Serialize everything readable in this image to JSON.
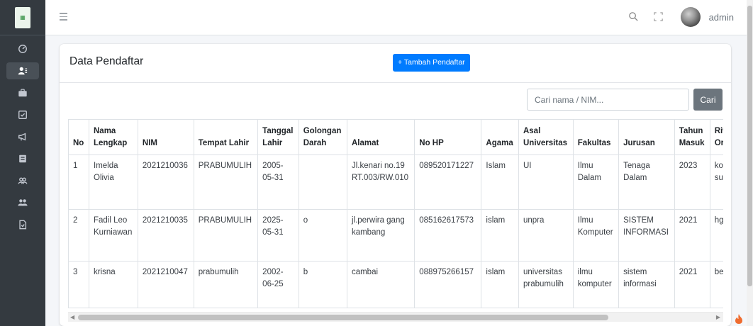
{
  "user": {
    "name": "admin"
  },
  "sidebar": {
    "icons": [
      "dashboard-icon",
      "users-icon",
      "briefcase-icon",
      "checkbox-icon",
      "megaphone-icon",
      "calendar-icon",
      "group-icon",
      "team-icon",
      "document-icon"
    ],
    "active_index": 1
  },
  "card": {
    "title": "Data Pendaftar",
    "add_button": "+ Tambah Pendaftar"
  },
  "search": {
    "placeholder": "Cari nama / NIM...",
    "button": "Cari"
  },
  "table": {
    "columns": [
      "No",
      "Nama Lengkap",
      "NIM",
      "Tempat Lahir",
      "Tanggal Lahir",
      "Golongan Darah",
      "Alamat",
      "No HP",
      "Agama",
      "Asal Universitas",
      "Fakultas",
      "Jurusan",
      "Tahun Masuk",
      "Riwayat Organisasi"
    ],
    "rows": [
      [
        "1",
        "Imelda Olivia",
        "2021210036",
        "PRABUMULIH",
        "2005-05-31",
        "",
        "Jl.kenari no.19 RT.003/RW.010",
        "089520171227",
        "Islam",
        "UI",
        "Ilmu Dalam",
        "Tenaga Dalam",
        "2023",
        "komnutas suka suka"
      ],
      [
        "2",
        "Fadil Leo Kurniawan",
        "2021210035",
        "PRABUMULIH",
        "2025-05-31",
        "o",
        "jl.perwira gang kambang",
        "085162617573",
        "islam",
        "unpra",
        "Ilmu Komputer",
        "SISTEM INFORMASI",
        "2021",
        "hgthfhgfhfj"
      ],
      [
        "3",
        "krisna",
        "2021210047",
        "prabumulih",
        "2002-06-25",
        "b",
        "cambai",
        "088975266157",
        "islam",
        "universitas prabumulih",
        "ilmu komputer",
        "sistem informasi",
        "2021",
        "bem unpra"
      ]
    ]
  },
  "colors": {
    "primary": "#007bff",
    "secondary": "#6c757d",
    "sidebar_bg": "#343a40"
  }
}
